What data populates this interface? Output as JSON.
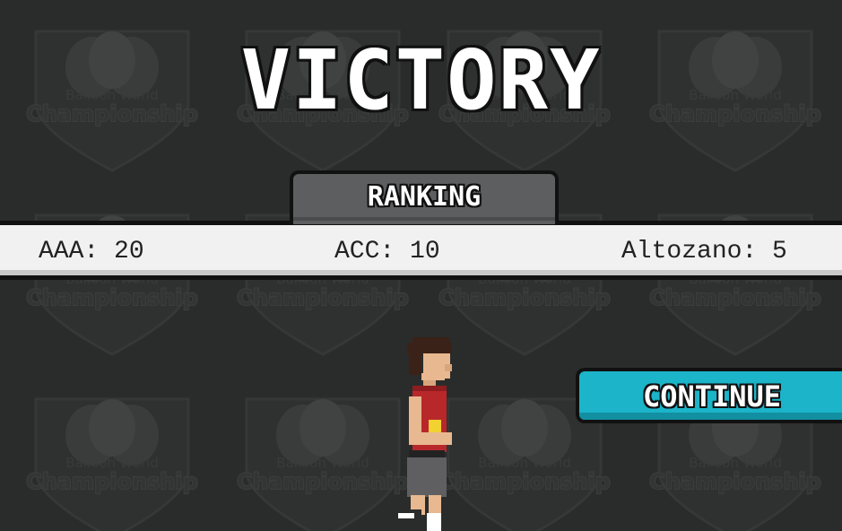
{
  "screen": {
    "title": "VICTORY",
    "ranking_label": "RANKING",
    "scores": [
      {
        "name": "AAA",
        "points": "20",
        "text": "AAA: 20"
      },
      {
        "name": "ACC",
        "points": "10",
        "text": "ACC: 10"
      },
      {
        "name": "Altozano",
        "points": "5",
        "text": "Altozano: 5"
      }
    ],
    "continue_label": "CONTINUE"
  },
  "watermark": {
    "line1": "Balloon World",
    "line2": "Championship"
  },
  "colors": {
    "background": "#2a2c2b",
    "ranking_tab": "#5d5e60",
    "ranking_bar": "#f1f1f1",
    "continue_button": "#1bb4c9",
    "player_shirt": "#b8282b"
  }
}
